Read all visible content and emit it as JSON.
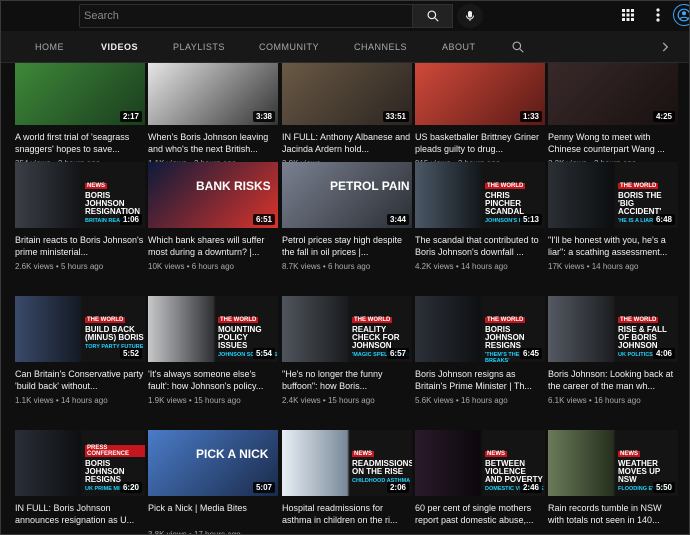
{
  "search": {
    "placeholder": "Search"
  },
  "tabs": [
    {
      "label": "HOME"
    },
    {
      "label": "VIDEOS"
    },
    {
      "label": "PLAYLISTS"
    },
    {
      "label": "COMMUNITY"
    },
    {
      "label": "CHANNELS"
    },
    {
      "label": "ABOUT"
    }
  ],
  "colors": {
    "accent": "#3ea6ff",
    "background": "#0f0f0f",
    "abc_blue": "#1fd3ff",
    "brand_red": "#c4161c"
  },
  "icons": {
    "search": "search-icon",
    "mic": "microphone-icon",
    "apps": "apps-grid-icon",
    "more": "more-vert-icon",
    "avatar": "account-icon",
    "next": "chevron-right-icon"
  },
  "videos": [
    {
      "duration": "2:17",
      "title": "A world first trial of 'seagrass snaggers' hopes to save...",
      "views": "354 views",
      "age": "2 hours ago",
      "badge": null
    },
    {
      "duration": "3:38",
      "title": "When's Boris Johnson leaving and who's the next British...",
      "views": "1.1K views",
      "age": "2 hours ago",
      "badge": null
    },
    {
      "duration": "33:51",
      "title": "IN FULL: Anthony Albanese and Jacinda Ardern hold...",
      "views": "3.9K views",
      "age": "Streamed 2 hours ago",
      "badge": null
    },
    {
      "duration": "1:33",
      "title": "US basketballer Brittney Griner pleads guilty to drug...",
      "views": "915 views",
      "age": "3 hours ago",
      "badge": null
    },
    {
      "duration": "4:25",
      "title": "Penny Wong to meet with Chinese counterpart Wang ...",
      "views": "2.2K views",
      "age": "3 hours ago",
      "badge": null
    },
    {
      "duration": "1:06",
      "title": "Britain reacts to Boris Johnson's prime ministerial...",
      "views": "2.6K views",
      "age": "5 hours ago",
      "badge": {
        "src": "NEWS",
        "h": "BORIS JOHNSON RESIGNATION",
        "sub": "BRITAIN REACTS"
      }
    },
    {
      "duration": "6:51",
      "title": "Which bank shares will suffer most during a downturn? |...",
      "views": "10K views",
      "age": "6 hours ago",
      "badge": {
        "src": "",
        "h": "BANK RISKS",
        "sub": ""
      }
    },
    {
      "duration": "3:44",
      "title": "Petrol prices stay high despite the fall in oil prices |...",
      "views": "8.7K views",
      "age": "6 hours ago",
      "badge": {
        "src": "",
        "h": "PETROL PAIN",
        "sub": ""
      }
    },
    {
      "duration": "5:13",
      "title": "The scandal that contributed to Boris Johnson's downfall ...",
      "views": "4.2K views",
      "age": "14 hours ago",
      "badge": {
        "src": "THE WORLD",
        "h": "CHRIS PINCHER SCANDAL",
        "sub": "JOHNSON'S END"
      }
    },
    {
      "duration": "6:48",
      "title": "\"I'll be honest with you, he's a liar\": a scathing assessment...",
      "views": "17K views",
      "age": "14 hours ago",
      "badge": {
        "src": "THE WORLD",
        "h": "BORIS THE 'BIG ACCIDENT'",
        "sub": "'HE IS A LIAR'"
      }
    },
    {
      "duration": "5:52",
      "title": "Can Britain's Conservative party 'build back' without...",
      "views": "1.1K views",
      "age": "14 hours ago",
      "badge": {
        "src": "THE WORLD",
        "h": "BUILD BACK (MINUS) BORIS",
        "sub": "TORY PARTY FUTURE"
      }
    },
    {
      "duration": "5:54",
      "title": "'It's always someone else's fault': how Johnson's policy...",
      "views": "1.9K views",
      "age": "15 hours ago",
      "badge": {
        "src": "THE WORLD",
        "h": "MOUNTING POLICY ISSUES",
        "sub": "JOHNSON SCANDALS"
      }
    },
    {
      "duration": "6:57",
      "title": "\"He's no longer the funny buffoon\": how Boris...",
      "views": "2.4K views",
      "age": "15 hours ago",
      "badge": {
        "src": "THE WORLD",
        "h": "REALITY CHECK FOR JOHNSON",
        "sub": "'MAGIC SPELL' ENDS"
      }
    },
    {
      "duration": "6:45",
      "title": "Boris Johnson resigns as Britain's Prime Minister | Th...",
      "views": "5.6K views",
      "age": "16 hours ago",
      "badge": {
        "src": "THE WORLD",
        "h": "BORIS JOHNSON RESIGNS",
        "sub": "'THEM'S THE BREAKS'"
      }
    },
    {
      "duration": "4:06",
      "title": "Boris Johnson: Looking back at the career of the man wh...",
      "views": "6.1K views",
      "age": "16 hours ago",
      "badge": {
        "src": "THE WORLD",
        "h": "RISE & FALL OF BORIS JOHNSON",
        "sub": "UK POLITICS"
      }
    },
    {
      "duration": "6:20",
      "title": "IN FULL: Boris Johnson announces resignation as U...",
      "views": "",
      "age": "",
      "badge": {
        "src": "PRESS CONFERENCE",
        "h": "BORIS JOHNSON RESIGNS",
        "sub": "UK PRIME MINISTER"
      }
    },
    {
      "duration": "5:07",
      "title": "Pick a Nick | Media Bites",
      "views": "3.8K views",
      "age": "17 hours ago",
      "badge": {
        "src": "",
        "h": "PICK A NICK",
        "sub": ""
      }
    },
    {
      "duration": "2:06",
      "title": "Hospital readmissions for asthma in children on the ri...",
      "views": "",
      "age": "",
      "badge": {
        "src": "NEWS",
        "h": "READMISSIONS ON THE RISE",
        "sub": "CHILDHOOD ASTHMA"
      }
    },
    {
      "duration": "2:46",
      "title": "60 per cent of single mothers report past domestic abuse,...",
      "views": "",
      "age": "",
      "badge": {
        "src": "NEWS",
        "h": "BETWEEN VIOLENCE AND POVERTY",
        "sub": "DOMESTIC VIOLENCE"
      }
    },
    {
      "duration": "5:50",
      "title": "Rain records tumble in NSW with totals not seen in 140...",
      "views": "",
      "age": "",
      "badge": {
        "src": "NEWS",
        "h": "WEATHER MOVES UP NSW",
        "sub": "FLOODING EVENT"
      }
    }
  ]
}
